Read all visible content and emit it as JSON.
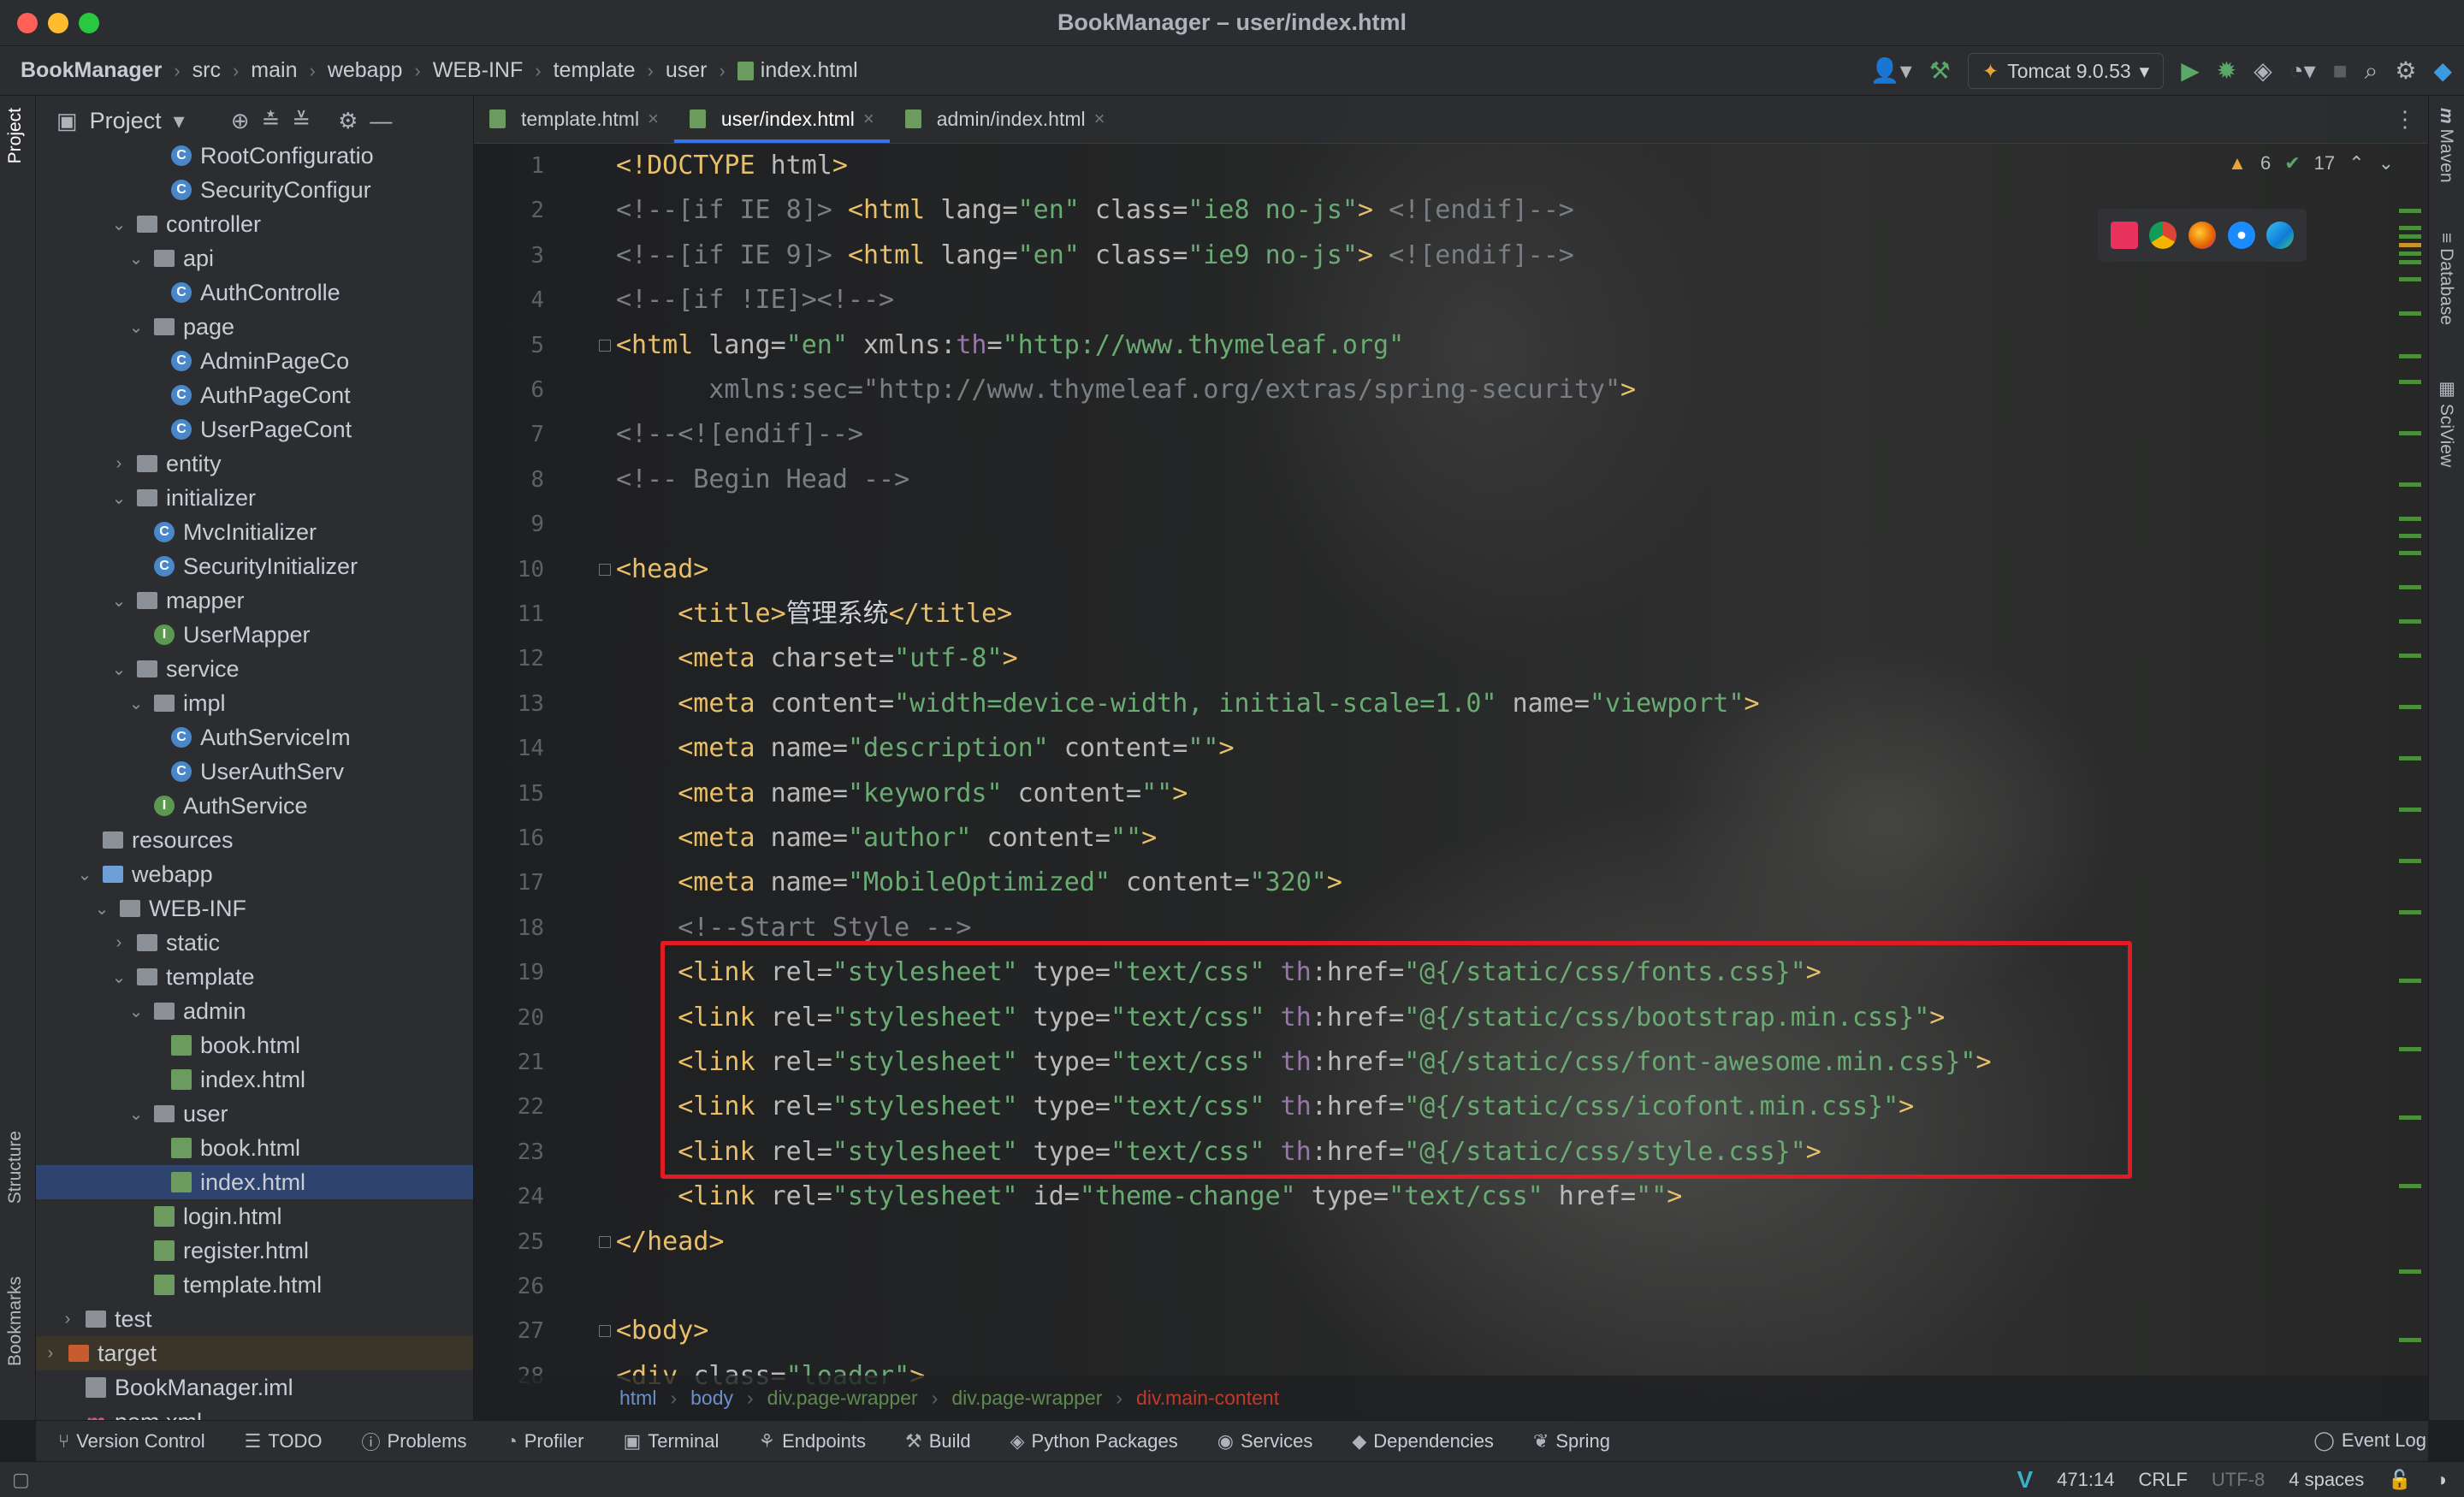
{
  "window_title": "BookManager – user/index.html",
  "breadcrumb": [
    {
      "label": "BookManager"
    },
    {
      "label": "src"
    },
    {
      "label": "main"
    },
    {
      "label": "webapp"
    },
    {
      "label": "WEB-INF"
    },
    {
      "label": "template"
    },
    {
      "label": "user"
    },
    {
      "label": "index.html"
    }
  ],
  "run_config": "Tomcat 9.0.53",
  "left_tool_tabs": [
    "Project",
    "Structure",
    "Bookmarks"
  ],
  "right_tool_tabs": [
    "Maven",
    "Database",
    "SciView"
  ],
  "project_panel": {
    "title": "Project",
    "tree": [
      {
        "label": "RootConfiguratio",
        "icon": "class-icon",
        "arrow": ""
      },
      {
        "label": "SecurityConfigur",
        "icon": "class-icon",
        "arrow": ""
      },
      {
        "label": "controller",
        "icon": "folder-icon",
        "arrow": "expanded"
      },
      {
        "label": "api",
        "icon": "folder-icon",
        "arrow": "expanded"
      },
      {
        "label": "AuthControlle",
        "icon": "class-icon",
        "arrow": ""
      },
      {
        "label": "page",
        "icon": "folder-icon",
        "arrow": "expanded"
      },
      {
        "label": "AdminPageCo",
        "icon": "class-icon",
        "arrow": ""
      },
      {
        "label": "AuthPageCont",
        "icon": "class-icon",
        "arrow": ""
      },
      {
        "label": "UserPageCont",
        "icon": "class-icon",
        "arrow": ""
      },
      {
        "label": "entity",
        "icon": "folder-icon",
        "arrow": "collapsed"
      },
      {
        "label": "initializer",
        "icon": "folder-icon",
        "arrow": "expanded"
      },
      {
        "label": "MvcInitializer",
        "icon": "class-icon",
        "arrow": ""
      },
      {
        "label": "SecurityInitializer",
        "icon": "class-icon",
        "arrow": ""
      },
      {
        "label": "mapper",
        "icon": "folder-icon",
        "arrow": "expanded"
      },
      {
        "label": "UserMapper",
        "icon": "interface-icon",
        "arrow": ""
      },
      {
        "label": "service",
        "icon": "folder-icon",
        "arrow": "expanded"
      },
      {
        "label": "impl",
        "icon": "folder-icon",
        "arrow": "expanded"
      },
      {
        "label": "AuthServiceIm",
        "icon": "class-icon",
        "arrow": ""
      },
      {
        "label": "UserAuthServ",
        "icon": "class-icon",
        "arrow": ""
      },
      {
        "label": "AuthService",
        "icon": "interface-icon",
        "arrow": ""
      },
      {
        "label": "resources",
        "icon": "folder-icon",
        "arrow": ""
      },
      {
        "label": "webapp",
        "icon": "web-folder-icon",
        "arrow": "expanded"
      },
      {
        "label": "WEB-INF",
        "icon": "folder-icon",
        "arrow": "expanded"
      },
      {
        "label": "static",
        "icon": "folder-icon",
        "arrow": "collapsed"
      },
      {
        "label": "template",
        "icon": "folder-icon",
        "arrow": "expanded"
      },
      {
        "label": "admin",
        "icon": "folder-icon",
        "arrow": "expanded"
      },
      {
        "label": "book.html",
        "icon": "html-file-icon",
        "arrow": ""
      },
      {
        "label": "index.html",
        "icon": "html-file-icon",
        "arrow": ""
      },
      {
        "label": "user",
        "icon": "folder-icon",
        "arrow": "expanded"
      },
      {
        "label": "book.html",
        "icon": "html-file-icon",
        "arrow": ""
      },
      {
        "label": "index.html",
        "icon": "html-file-icon",
        "arrow": "",
        "selected": true
      },
      {
        "label": "login.html",
        "icon": "html-file-icon",
        "arrow": ""
      },
      {
        "label": "register.html",
        "icon": "html-file-icon",
        "arrow": ""
      },
      {
        "label": "template.html",
        "icon": "html-file-icon",
        "arrow": ""
      },
      {
        "label": "test",
        "icon": "folder-icon",
        "arrow": "collapsed"
      },
      {
        "label": "target",
        "icon": "target-folder-icon",
        "arrow": "collapsed"
      },
      {
        "label": "BookManager.iml",
        "icon": "iml-file-icon",
        "arrow": ""
      },
      {
        "label": "pom.xml",
        "icon": "maven-pom-icon",
        "arrow": ""
      }
    ]
  },
  "editor_tabs": [
    {
      "label": "template.html",
      "active": false
    },
    {
      "label": "user/index.html",
      "active": true
    },
    {
      "label": "admin/index.html",
      "active": false
    }
  ],
  "inspections": {
    "warnings": "6",
    "passed": "17"
  },
  "code_lines": [
    {
      "n": "1",
      "segs": [
        [
          "tag",
          "<!DOCTYPE "
        ],
        [
          "att",
          "html"
        ],
        [
          "tag",
          ">"
        ]
      ]
    },
    {
      "n": "2",
      "segs": [
        [
          "cm",
          "<!--[if IE 8]> "
        ],
        [
          "tag",
          "<html "
        ],
        [
          "att",
          "lang="
        ],
        [
          "val",
          "\"en\""
        ],
        [
          "att",
          " class="
        ],
        [
          "val",
          "\"ie8 no-js\""
        ],
        [
          "tag",
          ">"
        ],
        [
          "cm",
          " <![endif]-->"
        ]
      ]
    },
    {
      "n": "3",
      "segs": [
        [
          "cm",
          "<!--[if IE 9]> "
        ],
        [
          "tag",
          "<html "
        ],
        [
          "att",
          "lang="
        ],
        [
          "val",
          "\"en\""
        ],
        [
          "att",
          " class="
        ],
        [
          "val",
          "\"ie9 no-js\""
        ],
        [
          "tag",
          ">"
        ],
        [
          "cm",
          " <![endif]-->"
        ]
      ]
    },
    {
      "n": "4",
      "segs": [
        [
          "cm",
          "<!--[if !IE]><!-->"
        ]
      ]
    },
    {
      "n": "5",
      "segs": [
        [
          "tag",
          "<html "
        ],
        [
          "att",
          "lang="
        ],
        [
          "val",
          "\"en\""
        ],
        [
          "att",
          " xmlns:"
        ],
        [
          "th",
          "th"
        ],
        [
          "att",
          "="
        ],
        [
          "val",
          "\"http://www.thymeleaf.org\""
        ]
      ]
    },
    {
      "n": "6",
      "segs": [
        [
          "cm",
          "      xmlns:sec=\"http://www.thymeleaf.org/extras/spring-security\""
        ],
        [
          "tag",
          ">"
        ]
      ]
    },
    {
      "n": "7",
      "segs": [
        [
          "cm",
          "<!--<![endif]-->"
        ]
      ]
    },
    {
      "n": "8",
      "segs": [
        [
          "cm",
          "<!-- Begin Head -->"
        ]
      ]
    },
    {
      "n": "9",
      "segs": []
    },
    {
      "n": "10",
      "segs": [
        [
          "tag",
          "<head>"
        ]
      ]
    },
    {
      "n": "11",
      "segs": [
        [
          "txt",
          "    "
        ],
        [
          "tag",
          "<title>"
        ],
        [
          "txt",
          "管理系统"
        ],
        [
          "tag",
          "</title>"
        ]
      ]
    },
    {
      "n": "12",
      "segs": [
        [
          "txt",
          "    "
        ],
        [
          "tag",
          "<meta "
        ],
        [
          "att",
          "charset="
        ],
        [
          "val",
          "\"utf-8\""
        ],
        [
          "tag",
          ">"
        ]
      ]
    },
    {
      "n": "13",
      "segs": [
        [
          "txt",
          "    "
        ],
        [
          "tag",
          "<meta "
        ],
        [
          "att",
          "content="
        ],
        [
          "val",
          "\"width=device-width, initial-scale=1.0\""
        ],
        [
          "att",
          " name="
        ],
        [
          "val",
          "\"viewport\""
        ],
        [
          "tag",
          ">"
        ]
      ]
    },
    {
      "n": "14",
      "segs": [
        [
          "txt",
          "    "
        ],
        [
          "tag",
          "<meta "
        ],
        [
          "att",
          "name="
        ],
        [
          "val",
          "\"description\""
        ],
        [
          "att",
          " content="
        ],
        [
          "val",
          "\"\""
        ],
        [
          "tag",
          ">"
        ]
      ]
    },
    {
      "n": "15",
      "segs": [
        [
          "txt",
          "    "
        ],
        [
          "tag",
          "<meta "
        ],
        [
          "att",
          "name="
        ],
        [
          "val",
          "\"keywords\""
        ],
        [
          "att",
          " content="
        ],
        [
          "val",
          "\"\""
        ],
        [
          "tag",
          ">"
        ]
      ]
    },
    {
      "n": "16",
      "segs": [
        [
          "txt",
          "    "
        ],
        [
          "tag",
          "<meta "
        ],
        [
          "att",
          "name="
        ],
        [
          "val",
          "\"author\""
        ],
        [
          "att",
          " content="
        ],
        [
          "val",
          "\"\""
        ],
        [
          "tag",
          ">"
        ]
      ]
    },
    {
      "n": "17",
      "segs": [
        [
          "txt",
          "    "
        ],
        [
          "tag",
          "<meta "
        ],
        [
          "att",
          "name="
        ],
        [
          "val",
          "\"MobileOptimized\""
        ],
        [
          "att",
          " content="
        ],
        [
          "val",
          "\"320\""
        ],
        [
          "tag",
          ">"
        ]
      ]
    },
    {
      "n": "18",
      "segs": [
        [
          "txt",
          "    "
        ],
        [
          "cm",
          "<!--Start Style -->"
        ]
      ]
    },
    {
      "n": "19",
      "segs": [
        [
          "txt",
          "    "
        ],
        [
          "tag",
          "<link "
        ],
        [
          "att",
          "rel="
        ],
        [
          "val",
          "\"stylesheet\""
        ],
        [
          "att",
          " type="
        ],
        [
          "val",
          "\"text/css\""
        ],
        [
          "th",
          " th"
        ],
        [
          "att",
          ":href="
        ],
        [
          "val",
          "\"@{/static/css/fonts.css}\""
        ],
        [
          "tag",
          ">"
        ]
      ]
    },
    {
      "n": "20",
      "segs": [
        [
          "txt",
          "    "
        ],
        [
          "tag",
          "<link "
        ],
        [
          "att",
          "rel="
        ],
        [
          "val",
          "\"stylesheet\""
        ],
        [
          "att",
          " type="
        ],
        [
          "val",
          "\"text/css\""
        ],
        [
          "th",
          " th"
        ],
        [
          "att",
          ":href="
        ],
        [
          "val",
          "\"@{/static/css/bootstrap.min.css}\""
        ],
        [
          "tag",
          ">"
        ]
      ]
    },
    {
      "n": "21",
      "segs": [
        [
          "txt",
          "    "
        ],
        [
          "tag",
          "<link "
        ],
        [
          "att",
          "rel="
        ],
        [
          "val",
          "\"stylesheet\""
        ],
        [
          "att",
          " type="
        ],
        [
          "val",
          "\"text/css\""
        ],
        [
          "th",
          " th"
        ],
        [
          "att",
          ":href="
        ],
        [
          "val",
          "\"@{/static/css/font-awesome.min.css}\""
        ],
        [
          "tag",
          ">"
        ]
      ]
    },
    {
      "n": "22",
      "segs": [
        [
          "txt",
          "    "
        ],
        [
          "tag",
          "<link "
        ],
        [
          "att",
          "rel="
        ],
        [
          "val",
          "\"stylesheet\""
        ],
        [
          "att",
          " type="
        ],
        [
          "val",
          "\"text/css\""
        ],
        [
          "th",
          " th"
        ],
        [
          "att",
          ":href="
        ],
        [
          "val",
          "\"@{/static/css/icofont.min.css}\""
        ],
        [
          "tag",
          ">"
        ]
      ]
    },
    {
      "n": "23",
      "segs": [
        [
          "txt",
          "    "
        ],
        [
          "tag",
          "<link "
        ],
        [
          "att",
          "rel="
        ],
        [
          "val",
          "\"stylesheet\""
        ],
        [
          "att",
          " type="
        ],
        [
          "val",
          "\"text/css\""
        ],
        [
          "th",
          " th"
        ],
        [
          "att",
          ":href="
        ],
        [
          "val",
          "\"@{/static/css/style.css}\""
        ],
        [
          "tag",
          ">"
        ]
      ]
    },
    {
      "n": "24",
      "segs": [
        [
          "txt",
          "    "
        ],
        [
          "tag",
          "<link "
        ],
        [
          "att",
          "rel="
        ],
        [
          "val",
          "\"stylesheet\""
        ],
        [
          "att",
          " id="
        ],
        [
          "val",
          "\"theme-change\""
        ],
        [
          "att",
          " type="
        ],
        [
          "val",
          "\"text/css\""
        ],
        [
          "att",
          " href="
        ],
        [
          "val",
          "\"\""
        ],
        [
          "tag",
          ">"
        ]
      ]
    },
    {
      "n": "25",
      "segs": [
        [
          "tag",
          "</head>"
        ]
      ]
    },
    {
      "n": "26",
      "segs": []
    },
    {
      "n": "27",
      "segs": [
        [
          "tag",
          "<body>"
        ]
      ]
    },
    {
      "n": "28",
      "segs": [
        [
          "tag",
          "<div "
        ],
        [
          "att",
          "class="
        ],
        [
          "val",
          "\"loader\""
        ],
        [
          "tag",
          ">"
        ]
      ]
    }
  ],
  "code_breadcrumb": [
    {
      "label": "html",
      "kind": "tag"
    },
    {
      "label": "body",
      "kind": "tag"
    },
    {
      "label": "div.page-wrapper",
      "kind": "div"
    },
    {
      "label": "div.page-wrapper",
      "kind": "div"
    },
    {
      "label": "div.main-content",
      "kind": "red"
    }
  ],
  "tool_windows": [
    {
      "label": "Version Control",
      "icon": "branch-icon"
    },
    {
      "label": "TODO",
      "icon": "list-icon"
    },
    {
      "label": "Problems",
      "icon": "problems-icon"
    },
    {
      "label": "Profiler",
      "icon": "profiler-icon"
    },
    {
      "label": "Terminal",
      "icon": "terminal-icon"
    },
    {
      "label": "Endpoints",
      "icon": "endpoints-icon"
    },
    {
      "label": "Build",
      "icon": "hammer-icon"
    },
    {
      "label": "Python Packages",
      "icon": "packages-icon"
    },
    {
      "label": "Services",
      "icon": "services-icon"
    },
    {
      "label": "Dependencies",
      "icon": "dependencies-icon"
    },
    {
      "label": "Spring",
      "icon": "spring-icon"
    }
  ],
  "event_log": "Event Log",
  "status_bar": {
    "position": "471:14",
    "line_sep": "CRLF",
    "encoding": "UTF-8",
    "indent": "4 spaces"
  },
  "colors": {
    "highlight_box": "#e11b24",
    "selection": "#2e436e",
    "accent": "#3574f0"
  }
}
